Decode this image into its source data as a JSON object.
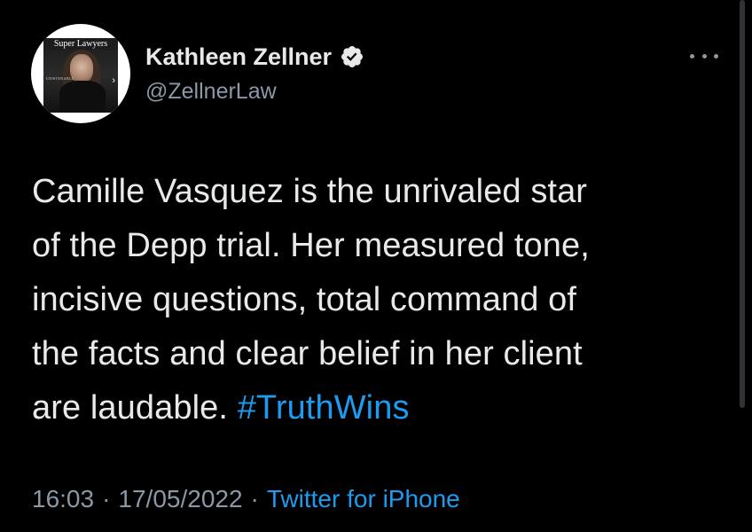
{
  "colors": {
    "background": "#000000",
    "text": "#e7e9ea",
    "secondary": "#8b98a5",
    "accent": "#1d9bf0",
    "verified_badge": "#e7e9ea"
  },
  "author": {
    "avatar_brand": "Super Lawyers",
    "avatar_tag": "UNWINNABLE",
    "display_name": "Kathleen Zellner",
    "handle": "@ZellnerLaw",
    "verified_icon": "verified-badge-icon"
  },
  "tweet": {
    "lines": [
      "Camille Vasquez is the unrivaled star",
      "of the Depp trial. Her measured tone,",
      "incisive questions, total command of",
      "the facts and clear belief in her client",
      "are laudable. "
    ],
    "hashtag": "#TruthWins"
  },
  "meta": {
    "time": "16:03",
    "separator": "·",
    "date": "17/05/2022",
    "source": "Twitter for iPhone"
  },
  "more_icon": "more-horizontal-icon"
}
